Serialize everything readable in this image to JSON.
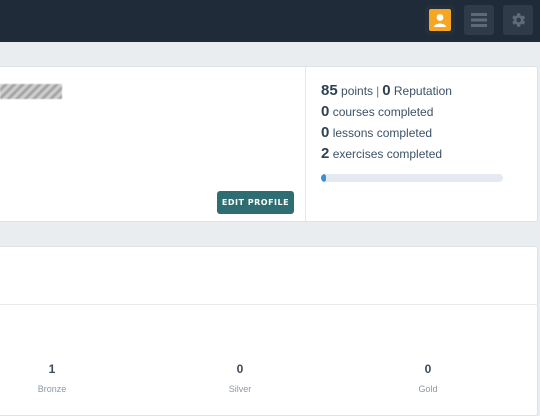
{
  "topbar": {
    "icons": [
      "profile-icon",
      "menu-icon",
      "gear-icon"
    ],
    "colors": {
      "background": "#1f2b38",
      "avatar_accent": "#f5a623"
    }
  },
  "profile": {
    "edit_button_label": "EDIT PROFILE"
  },
  "stats": {
    "points": "85",
    "points_label": "points",
    "separator": "|",
    "reputation": "0",
    "reputation_label": "Reputation",
    "courses": "0",
    "courses_label": "courses completed",
    "lessons": "0",
    "lessons_label": "lessons completed",
    "exercises": "2",
    "exercises_label": "exercises completed",
    "progress_fraction": 0.03
  },
  "badges": [
    {
      "count": "1",
      "label": "Bronze"
    },
    {
      "count": "0",
      "label": "Silver"
    },
    {
      "count": "0",
      "label": "Gold"
    }
  ]
}
